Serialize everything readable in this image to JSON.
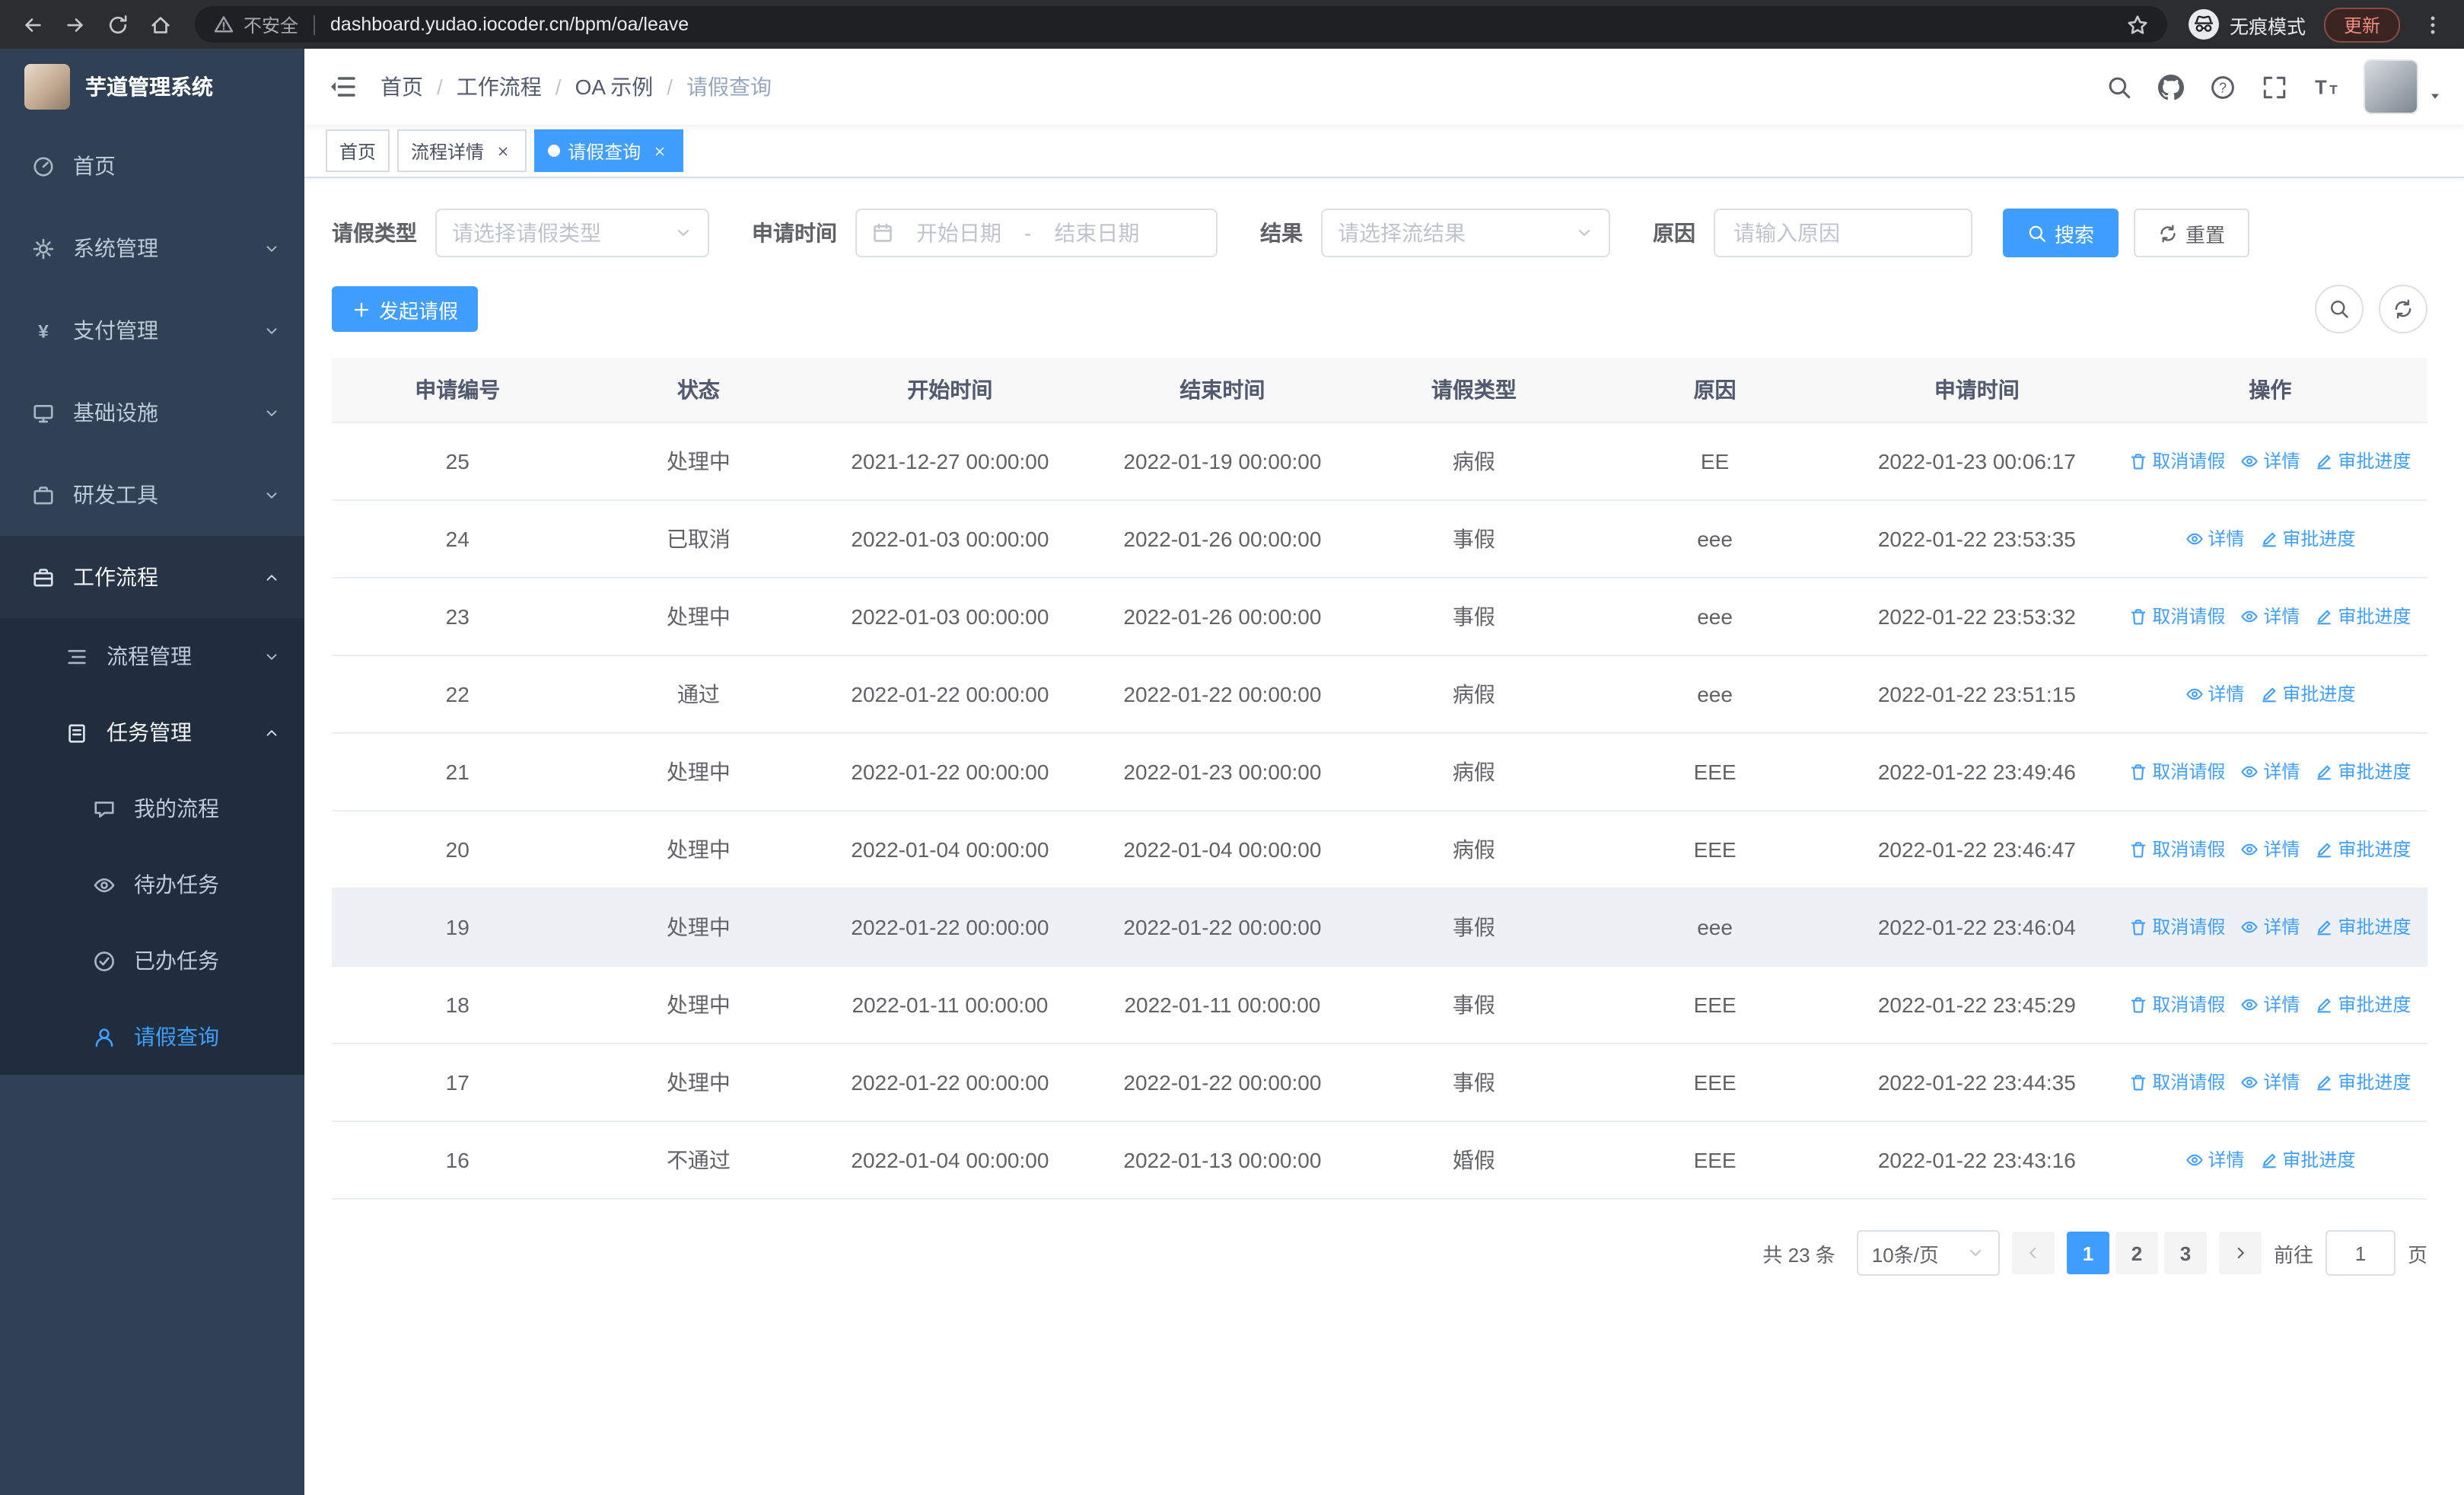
{
  "colors": {
    "primary": "#409eff",
    "sidebar_bg": "#304156",
    "submenu_bg": "#1f2d3d"
  },
  "browser": {
    "warning_label": "不安全",
    "url": "dashboard.yudao.iocoder.cn/bpm/oa/leave",
    "incognito_label": "无痕模式",
    "update_label": "更新"
  },
  "sidebar": {
    "app_title": "芋道管理系统",
    "items": [
      {
        "key": "home",
        "label": "首页",
        "icon": "dashboard-icon",
        "level": 1
      },
      {
        "key": "system",
        "label": "系统管理",
        "icon": "gear-icon",
        "level": 1,
        "arrow": "down"
      },
      {
        "key": "payment",
        "label": "支付管理",
        "icon": "yen-icon",
        "level": 1,
        "arrow": "down"
      },
      {
        "key": "infrastructure",
        "label": "基础设施",
        "icon": "monitor-icon",
        "level": 1,
        "arrow": "down"
      },
      {
        "key": "dev-tools",
        "label": "研发工具",
        "icon": "briefcase-icon",
        "level": 1,
        "arrow": "down"
      },
      {
        "key": "workflow",
        "label": "工作流程",
        "icon": "workflow-icon",
        "level": 1,
        "arrow": "up",
        "open": true
      },
      {
        "key": "process-management",
        "label": "流程管理",
        "icon": "list-icon",
        "level": 2,
        "arrow": "down"
      },
      {
        "key": "task-management",
        "label": "任务管理",
        "icon": "clipboard-icon",
        "level": 2,
        "arrow": "up",
        "open": true
      },
      {
        "key": "my-process",
        "label": "我的流程",
        "icon": "message-icon",
        "level": 3
      },
      {
        "key": "todo-tasks",
        "label": "待办任务",
        "icon": "eye-icon",
        "level": 3
      },
      {
        "key": "done-tasks",
        "label": "已办任务",
        "icon": "check-circle-icon",
        "level": 3
      },
      {
        "key": "leave-query",
        "label": "请假查询",
        "icon": "user-icon",
        "level": 3,
        "active": true
      }
    ]
  },
  "header": {
    "breadcrumb": [
      "首页",
      "工作流程",
      "OA 示例",
      "请假查询"
    ],
    "separator": "/",
    "icons": [
      "search-icon",
      "github-icon",
      "help-icon",
      "fullscreen-icon",
      "fontsize-icon"
    ]
  },
  "tabs": [
    {
      "key": "home",
      "label": "首页",
      "closable": false,
      "active": false
    },
    {
      "key": "process-detail",
      "label": "流程详情",
      "closable": true,
      "active": false
    },
    {
      "key": "leave-query",
      "label": "请假查询",
      "closable": true,
      "active": true
    }
  ],
  "filters": {
    "leave_type": {
      "label": "请假类型",
      "placeholder": "请选择请假类型"
    },
    "apply_time": {
      "label": "申请时间",
      "start_placeholder": "开始日期",
      "separator": "-",
      "end_placeholder": "结束日期"
    },
    "result": {
      "label": "结果",
      "placeholder": "请选择流结果"
    },
    "reason": {
      "label": "原因",
      "placeholder": "请输入原因"
    },
    "search_label": "搜索",
    "reset_label": "重置"
  },
  "toolbar": {
    "create_label": "发起请假"
  },
  "table": {
    "columns": [
      "申请编号",
      "状态",
      "开始时间",
      "结束时间",
      "请假类型",
      "原因",
      "申请时间",
      "操作"
    ],
    "actions": {
      "cancel": {
        "label": "取消请假",
        "icon": "trash-icon"
      },
      "detail": {
        "label": "详情",
        "icon": "eye-icon"
      },
      "progress": {
        "label": "审批进度",
        "icon": "edit-icon"
      }
    },
    "rows": [
      {
        "id": "25",
        "status": "处理中",
        "start": "2021-12-27 00:00:00",
        "end": "2022-01-19 00:00:00",
        "type": "病假",
        "reason": "EE",
        "apply_time": "2022-01-23 00:06:17",
        "actions": [
          "cancel",
          "detail",
          "progress"
        ]
      },
      {
        "id": "24",
        "status": "已取消",
        "start": "2022-01-03 00:00:00",
        "end": "2022-01-26 00:00:00",
        "type": "事假",
        "reason": "eee",
        "apply_time": "2022-01-22 23:53:35",
        "actions": [
          "detail",
          "progress"
        ]
      },
      {
        "id": "23",
        "status": "处理中",
        "start": "2022-01-03 00:00:00",
        "end": "2022-01-26 00:00:00",
        "type": "事假",
        "reason": "eee",
        "apply_time": "2022-01-22 23:53:32",
        "actions": [
          "cancel",
          "detail",
          "progress"
        ]
      },
      {
        "id": "22",
        "status": "通过",
        "start": "2022-01-22 00:00:00",
        "end": "2022-01-22 00:00:00",
        "type": "病假",
        "reason": "eee",
        "apply_time": "2022-01-22 23:51:15",
        "actions": [
          "detail",
          "progress"
        ]
      },
      {
        "id": "21",
        "status": "处理中",
        "start": "2022-01-22 00:00:00",
        "end": "2022-01-23 00:00:00",
        "type": "病假",
        "reason": "EEE",
        "apply_time": "2022-01-22 23:49:46",
        "actions": [
          "cancel",
          "detail",
          "progress"
        ]
      },
      {
        "id": "20",
        "status": "处理中",
        "start": "2022-01-04 00:00:00",
        "end": "2022-01-04 00:00:00",
        "type": "病假",
        "reason": "EEE",
        "apply_time": "2022-01-22 23:46:47",
        "actions": [
          "cancel",
          "detail",
          "progress"
        ]
      },
      {
        "id": "19",
        "status": "处理中",
        "start": "2022-01-22 00:00:00",
        "end": "2022-01-22 00:00:00",
        "type": "事假",
        "reason": "eee",
        "apply_time": "2022-01-22 23:46:04",
        "actions": [
          "cancel",
          "detail",
          "progress"
        ],
        "highlighted": true
      },
      {
        "id": "18",
        "status": "处理中",
        "start": "2022-01-11 00:00:00",
        "end": "2022-01-11 00:00:00",
        "type": "事假",
        "reason": "EEE",
        "apply_time": "2022-01-22 23:45:29",
        "actions": [
          "cancel",
          "detail",
          "progress"
        ]
      },
      {
        "id": "17",
        "status": "处理中",
        "start": "2022-01-22 00:00:00",
        "end": "2022-01-22 00:00:00",
        "type": "事假",
        "reason": "EEE",
        "apply_time": "2022-01-22 23:44:35",
        "actions": [
          "cancel",
          "detail",
          "progress"
        ]
      },
      {
        "id": "16",
        "status": "不通过",
        "start": "2022-01-04 00:00:00",
        "end": "2022-01-13 00:00:00",
        "type": "婚假",
        "reason": "EEE",
        "apply_time": "2022-01-22 23:43:16",
        "actions": [
          "detail",
          "progress"
        ]
      }
    ]
  },
  "pagination": {
    "total_label": "共 23 条",
    "page_size": "10条/页",
    "pages": [
      "1",
      "2",
      "3"
    ],
    "active_page": "1",
    "goto_label": "前往",
    "goto_value": "1",
    "page_unit": "页"
  }
}
